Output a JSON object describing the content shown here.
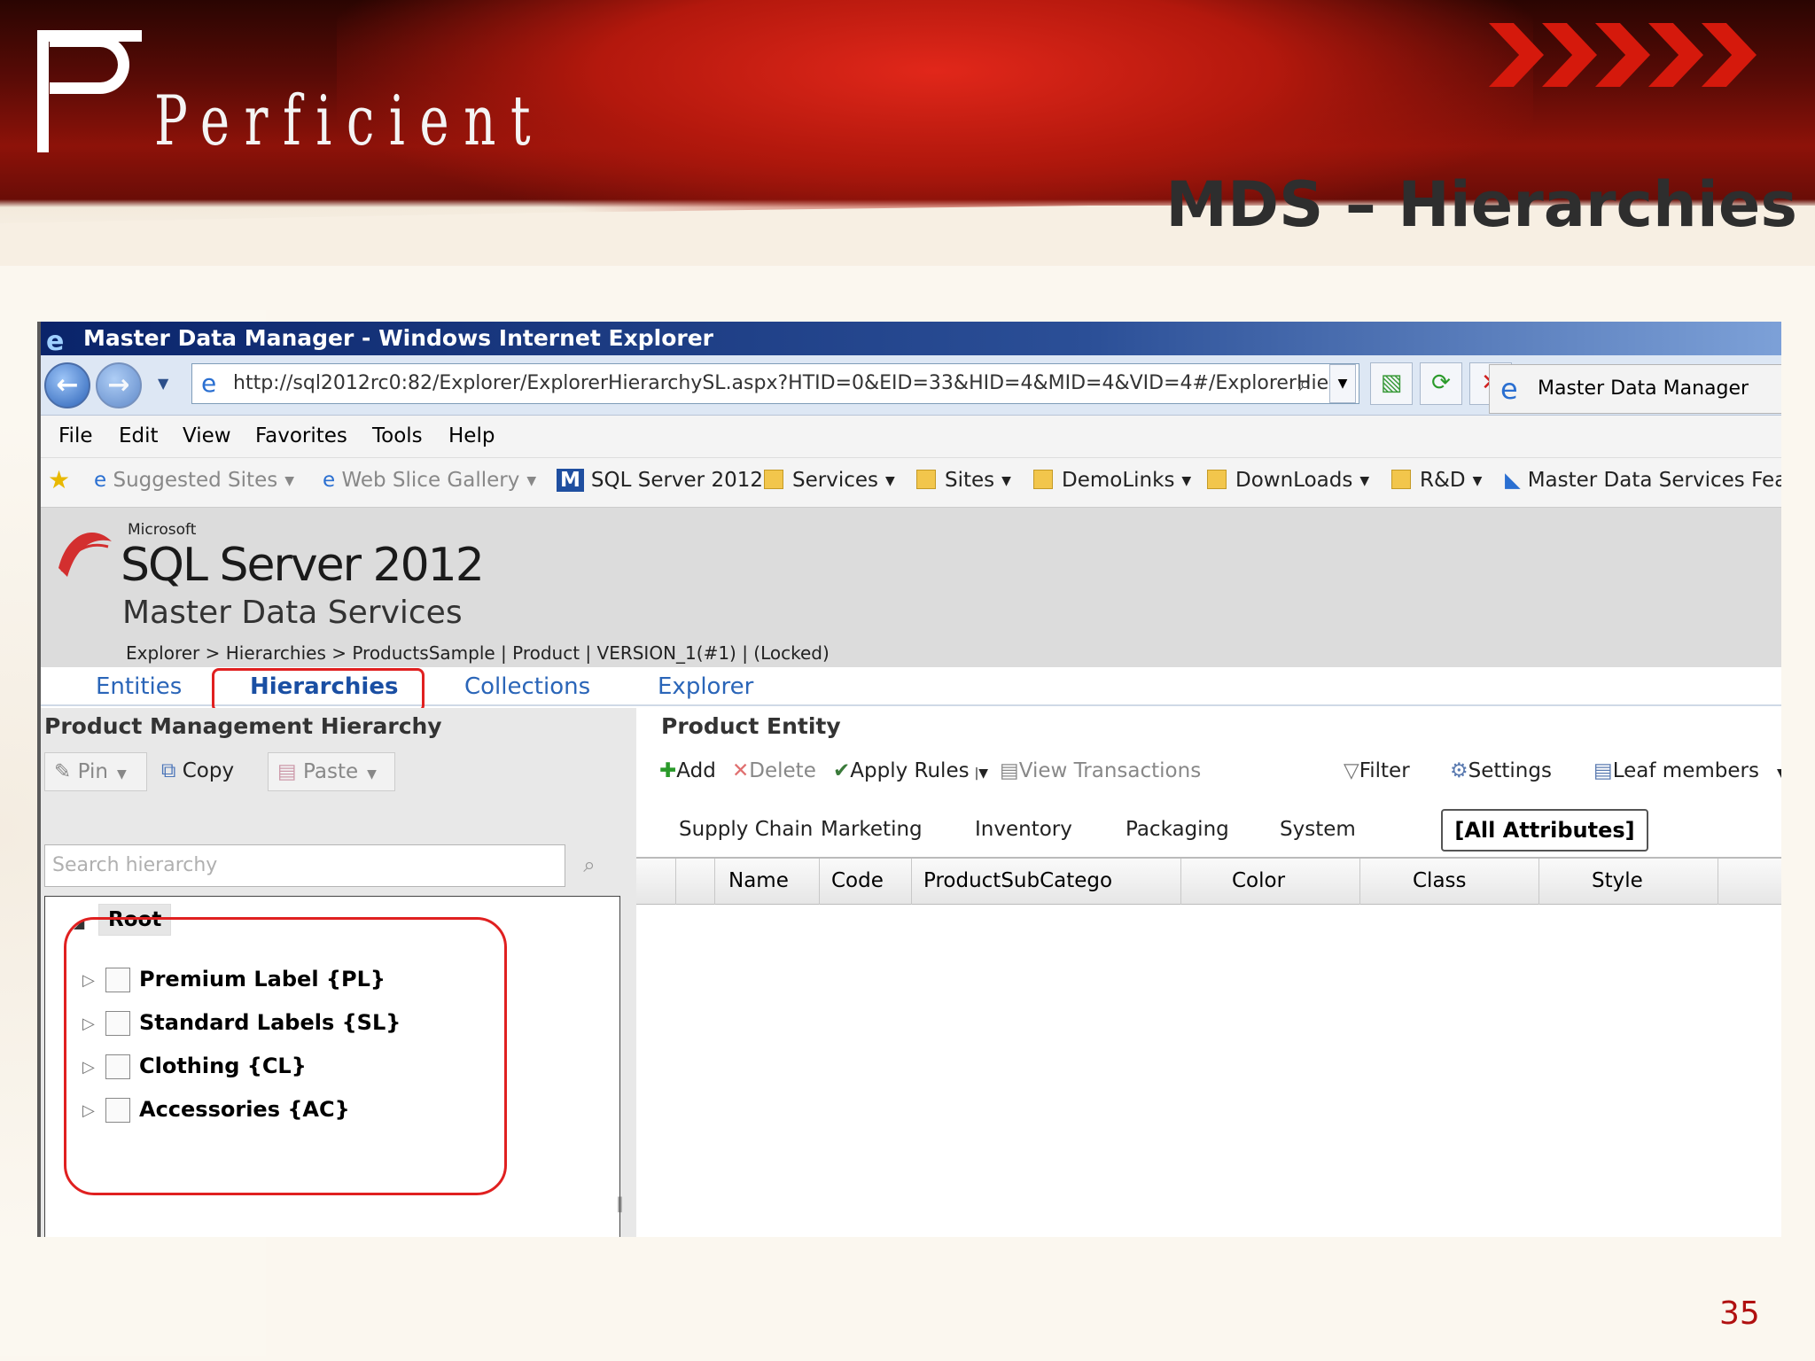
{
  "slide": {
    "logo_text": "Perficient",
    "title": "MDS – Hierarchies",
    "page_number": "35"
  },
  "browser": {
    "window_title": "Master Data Manager - Windows Internet Explorer",
    "address": "http://sql2012rc0:82/Explorer/ExplorerHierarchySL.aspx?HTID=0&EID=33&HID=4&MID=4&VID=4#/ExplorerHie",
    "tab_title": "Master Data Manager",
    "menu": [
      "File",
      "Edit",
      "View",
      "Favorites",
      "Tools",
      "Help"
    ],
    "favorites": [
      "Suggested Sites",
      "Web Slice Gallery",
      "SQL Server 2012",
      "Services",
      "Sites",
      "DemoLinks",
      "DownLoads",
      "R&D",
      "Master Data Services Feat"
    ]
  },
  "app": {
    "brand_small": "Microsoft",
    "brand": "SQL Server 2012",
    "product": "Master Data Services",
    "breadcrumb": "Explorer > Hierarchies > ProductsSample | Product | VERSION_1(#1) | (Locked)",
    "tabs": [
      "Entities",
      "Hierarchies",
      "Collections",
      "Explorer"
    ],
    "left_pane": {
      "title": "Product Management Hierarchy",
      "buttons": {
        "pin": "Pin",
        "copy": "Copy",
        "paste": "Paste"
      },
      "search_placeholder": "Search hierarchy",
      "root": "Root",
      "nodes": [
        "Premium Label {PL}",
        "Standard Labels {SL}",
        "Clothing {CL}",
        "Accessories {AC}"
      ]
    },
    "right_pane": {
      "title": "Product Entity",
      "toolbar": {
        "add": "Add",
        "delete": "Delete",
        "apply_rules": "Apply Rules",
        "view_transactions": "View Transactions",
        "filter": "Filter",
        "settings": "Settings",
        "leaf_members": "Leaf members"
      },
      "attribute_tabs": [
        "Supply Chain",
        "Marketing",
        "Inventory",
        "Packaging",
        "System",
        "[All Attributes]"
      ],
      "columns": [
        "Name",
        "Code",
        "ProductSubCatego",
        "Color",
        "Class",
        "Style"
      ]
    }
  },
  "colors": {
    "highlight": "#e02020",
    "link": "#2a65b8",
    "banner": "#8d1209"
  }
}
